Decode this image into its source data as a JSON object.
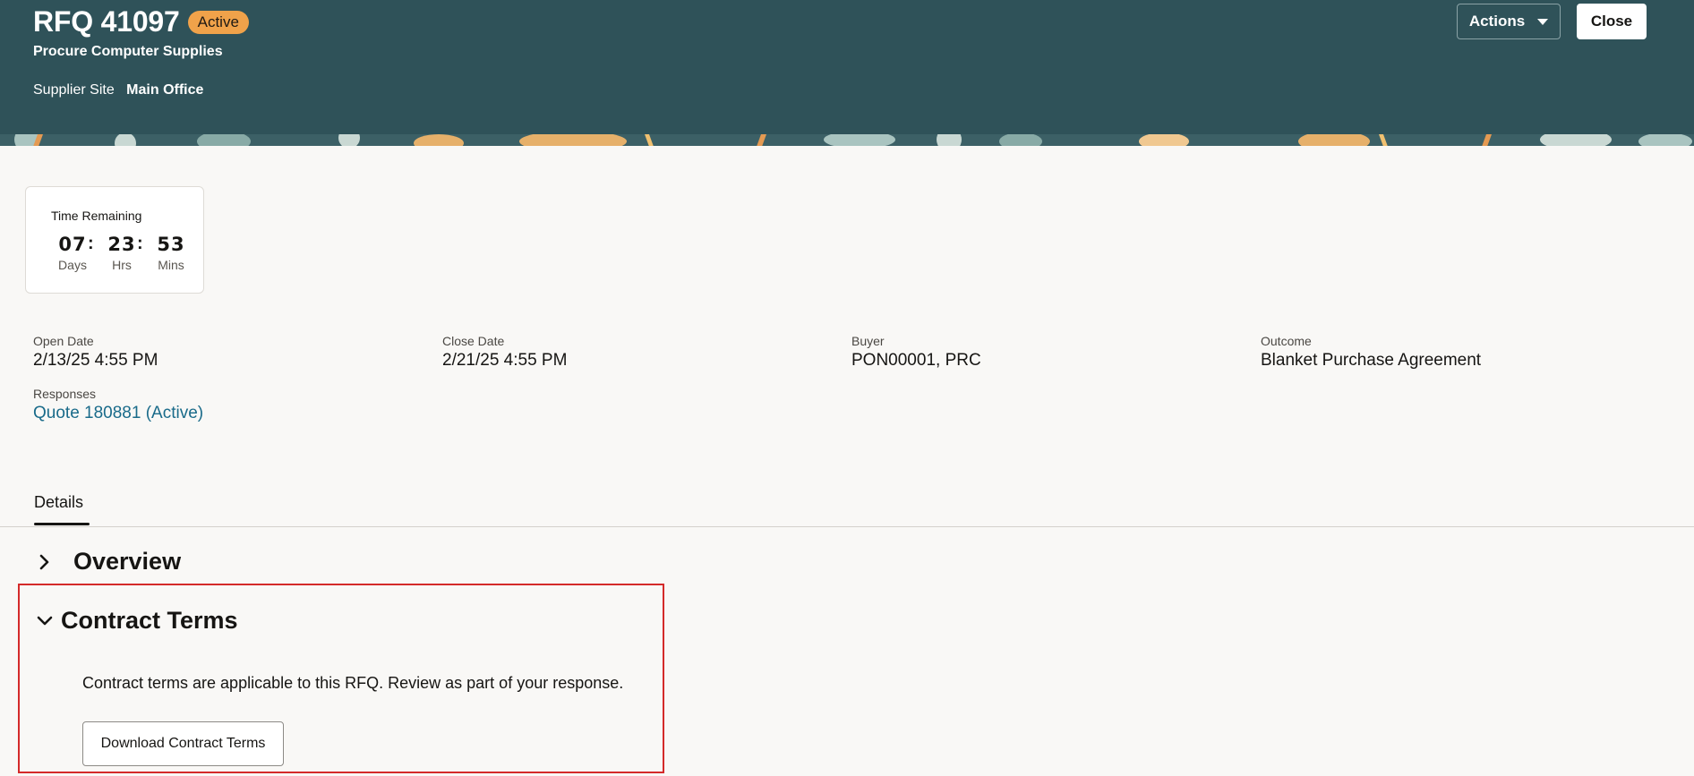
{
  "header": {
    "title": "RFQ 41097",
    "status": "Active",
    "subtitle": "Procure Computer Supplies",
    "supplier_site_label": "Supplier Site",
    "supplier_site_value": "Main Office",
    "actions_label": "Actions",
    "close_label": "Close"
  },
  "time_remaining": {
    "label": "Time Remaining",
    "days": "07",
    "hrs": "23",
    "mins": "53",
    "days_label": "Days",
    "hrs_label": "Hrs",
    "mins_label": "Mins",
    "separator": ":"
  },
  "fields": {
    "open_date": {
      "label": "Open Date",
      "value": "2/13/25 4:55 PM"
    },
    "close_date": {
      "label": "Close Date",
      "value": "2/21/25 4:55 PM"
    },
    "buyer": {
      "label": "Buyer",
      "value": "PON00001, PRC"
    },
    "outcome": {
      "label": "Outcome",
      "value": "Blanket Purchase Agreement"
    },
    "responses": {
      "label": "Responses",
      "value": "Quote 180881 (Active)"
    }
  },
  "tabs": [
    {
      "label": "Details",
      "selected": true
    }
  ],
  "sections": {
    "overview": {
      "title": "Overview",
      "expanded": false
    },
    "contract_terms": {
      "title": "Contract Terms",
      "expanded": true,
      "text": "Contract terms are applicable to this RFQ. Review as part of your response.",
      "download_label": "Download Contract Terms"
    }
  },
  "colors": {
    "header_bg": "#2f5259",
    "badge_bg": "#f0a24a",
    "link": "#1a6b8a",
    "highlight_border": "#d42a2a"
  }
}
